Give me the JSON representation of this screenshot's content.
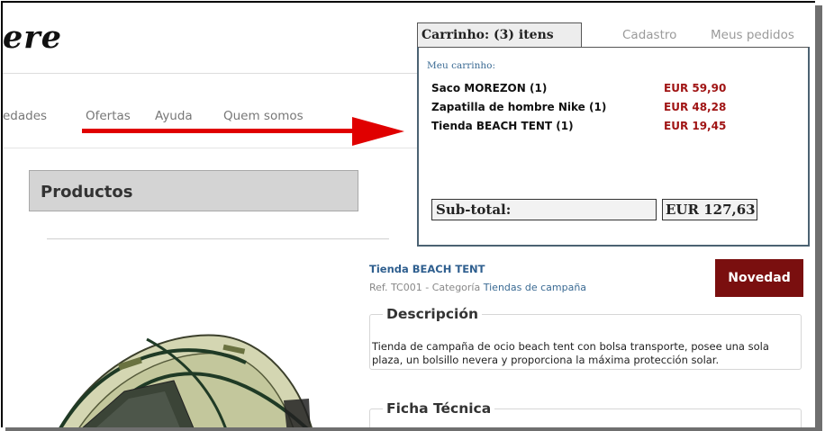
{
  "brand": {
    "logo_text": "ere"
  },
  "nav": {
    "items": [
      "edades",
      "Ofertas",
      "Ayuda",
      "Quem somos"
    ]
  },
  "top_nav": {
    "register": "Cadastro",
    "orders": "Meus pedidos"
  },
  "section": {
    "title": "Productos"
  },
  "cart": {
    "tab_label": "Carrinho: (3) itens",
    "title": "Meu carrinho:",
    "items": [
      {
        "name": "Saco MOREZON (1)",
        "price": "EUR 59,90"
      },
      {
        "name": "Zapatilla de hombre Nike (1)",
        "price": "EUR 48,28"
      },
      {
        "name": "Tienda BEACH TENT (1)",
        "price": "EUR 19,45"
      }
    ],
    "subtotal_label": "Sub-total:",
    "subtotal_value": "EUR 127,63"
  },
  "product": {
    "name": "Tienda BEACH TENT",
    "ref_prefix": "Ref. TC001 - Categoría ",
    "category": "Tiendas de campaña",
    "badge": "Novedad",
    "description_title": "Descripción",
    "description": "Tienda de campaña de ocio beach tent con bolsa transporte, posee una sola plaza, un bolsillo nevera y proporciona la máxima protección solar.",
    "spec_title": "Ficha Técnica"
  },
  "colors": {
    "accent_red": "#a01414",
    "badge_bg": "#7a0f0f",
    "link_blue": "#2f5f8f",
    "arrow": "#e00000"
  }
}
